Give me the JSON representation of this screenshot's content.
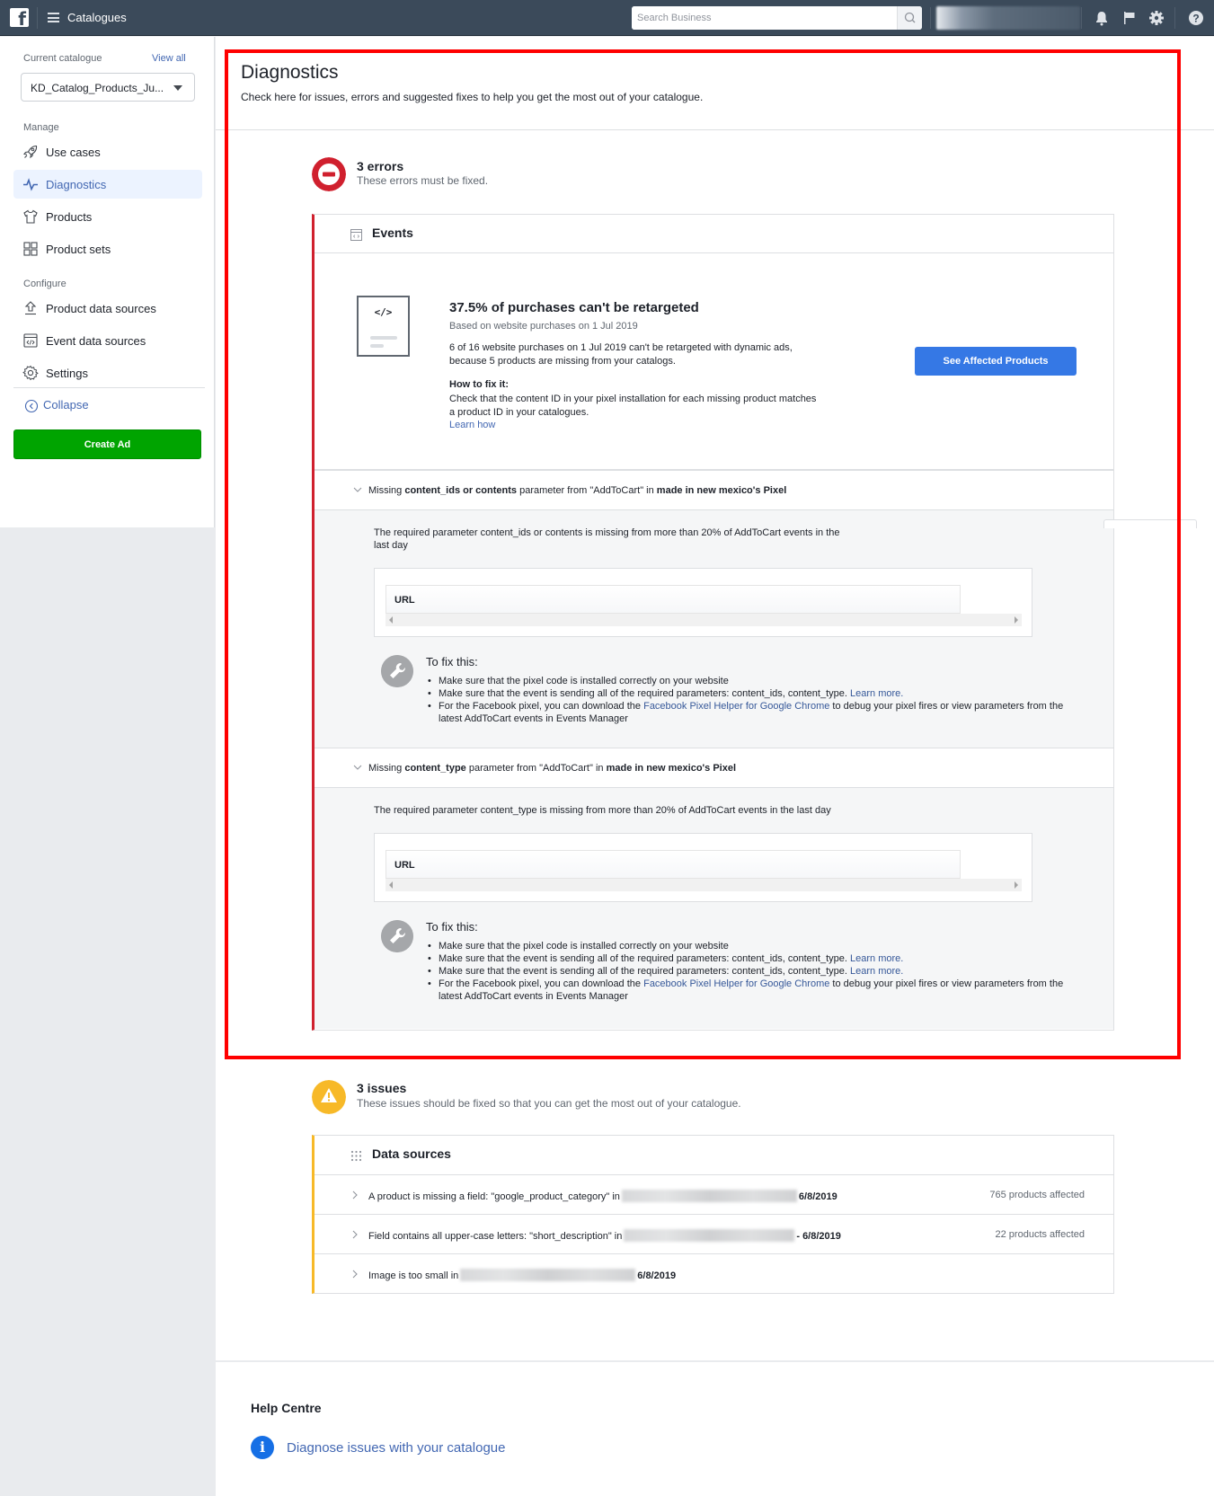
{
  "topbar": {
    "app_title": "Catalogues",
    "search_placeholder": "Search Business",
    "icons": [
      "facebook-logo",
      "menu-icon",
      "search-icon",
      "bell-icon",
      "flag-icon",
      "gear-icon",
      "help-icon"
    ]
  },
  "sidebar": {
    "current_catalogue_label": "Current catalogue",
    "view_all": "View all",
    "catalogue_selected": "KD_Catalog_Products_Ju...",
    "manage_label": "Manage",
    "manage_items": [
      {
        "label": "Use cases",
        "icon": "rocket-icon"
      },
      {
        "label": "Diagnostics",
        "icon": "pulse-icon",
        "active": true
      },
      {
        "label": "Products",
        "icon": "shirt-icon"
      },
      {
        "label": "Product sets",
        "icon": "grid-icon"
      }
    ],
    "configure_label": "Configure",
    "configure_items": [
      {
        "label": "Product data sources",
        "icon": "upload-icon"
      },
      {
        "label": "Event data sources",
        "icon": "code-window-icon"
      },
      {
        "label": "Settings",
        "icon": "gear-icon"
      }
    ],
    "collapse": "Collapse",
    "create_ad": "Create Ad"
  },
  "page": {
    "title": "Diagnostics",
    "subtitle": "Check here for issues, errors and suggested fixes to help you get the most out of your catalogue."
  },
  "errors": {
    "title": "3 errors",
    "subtitle": "These errors must be fixed.",
    "card_title": "Events",
    "insight": {
      "title": "37.5% of purchases can't be retargeted",
      "basis": "Based on website purchases on 1 Jul 2019",
      "body": "6 of 16 website purchases on 1 Jul 2019 can't be retargeted with dynamic ads, because 5 products are missing from your catalogs.",
      "how_heading": "How to fix it:",
      "how_body": "Check that the content ID in your pixel installation for each missing product matches a product ID in your catalogues.",
      "learn_how": "Learn how",
      "button": "See Affected Products"
    },
    "issues": [
      {
        "prefix": "Missing ",
        "param": "content_ids or contents",
        "middle": " parameter from \"AddToCart\" in ",
        "pixel": "made in new mexico's Pixel",
        "description": "The required parameter content_ids or contents is missing from more than 20% of AddToCart events in the last day",
        "table_header": "URL",
        "fix_heading": "To fix this:",
        "fixes": [
          {
            "text": "Make sure that the pixel code is installed correctly on your website"
          },
          {
            "text": "Make sure that the event is sending all of the required parameters: content_ids, content_type. ",
            "link": "Learn more."
          },
          {
            "text": "For the Facebook pixel, you can download the ",
            "link": "Facebook Pixel Helper for Google Chrome",
            "after": " to debug your pixel fires or view parameters from the latest AddToCart events in Events Manager"
          }
        ]
      },
      {
        "prefix": "Missing ",
        "param": "content_type",
        "middle": " parameter from \"AddToCart\" in ",
        "pixel": "made in new mexico's Pixel",
        "description": "The required parameter content_type is missing from more than 20% of AddToCart events in the last day",
        "table_header": "URL",
        "fix_heading": "To fix this:",
        "fixes": [
          {
            "text": "Make sure that the pixel code is installed correctly on your website"
          },
          {
            "text": "Make sure that the event is sending all of the required parameters: content_ids, content_type. ",
            "link": "Learn more."
          },
          {
            "text": "Make sure that the event is sending all of the required parameters: content_ids, content_type. ",
            "link": "Learn more."
          },
          {
            "text": "For the Facebook pixel, you can download the ",
            "link": "Facebook Pixel Helper for Google Chrome",
            "after": " to debug your pixel fires or view parameters from the latest AddToCart events in Events Manager"
          }
        ]
      }
    ]
  },
  "warnings": {
    "title": "3 issues",
    "subtitle": "These issues should be fixed so that you can get the most out of your catalogue.",
    "card_title": "Data sources",
    "rows": [
      {
        "text": "A product is missing a field: \"google_product_category\" in",
        "date": "6/8/2019",
        "count": "765 products affected"
      },
      {
        "text": "Field contains all upper-case letters: \"short_description\" in",
        "date": "- 6/8/2019",
        "count": "22 products affected"
      },
      {
        "text": "Image is too small in",
        "date": "6/8/2019",
        "count": ""
      }
    ]
  },
  "help": {
    "title": "Help Centre",
    "link": "Diagnose issues with your catalogue"
  },
  "colors": {
    "topbar": "#3b4a5a",
    "error": "#d0202e",
    "warning": "#f7b928",
    "primary_button": "#3578e5",
    "create_ad": "#00a400",
    "link": "#4267b2",
    "highlight": "#ff0000"
  }
}
